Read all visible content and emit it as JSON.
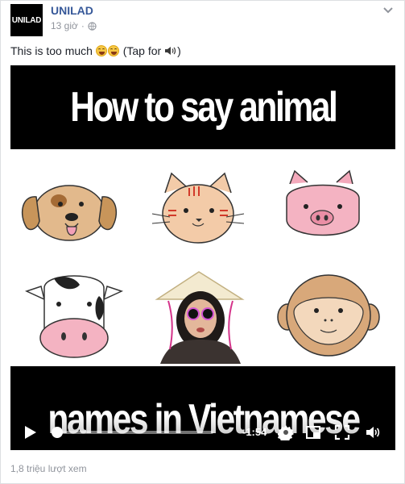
{
  "post": {
    "page_name": "UNILAD",
    "avatar_text": "UNILAD",
    "time": "13 giờ",
    "separator": "·",
    "text_before": "This is too much",
    "text_after": "(Tap for",
    "text_close": ")"
  },
  "video": {
    "title_top": "How to say animal",
    "title_bottom": "names in Vietnamese",
    "remaining_time": "-1:54",
    "progress": 0.03
  },
  "footer": {
    "views": "1,8 triệu lượt xem"
  },
  "icons": [
    "globe-icon",
    "chevron-down-icon",
    "play-icon",
    "gear-icon",
    "pip-icon",
    "fullscreen-icon",
    "volume-icon",
    "speaker-emoji-icon",
    "laughing-emoji-icon"
  ],
  "colors": {
    "link": "#365899",
    "meta": "#90949c",
    "video_band": "#000000"
  }
}
